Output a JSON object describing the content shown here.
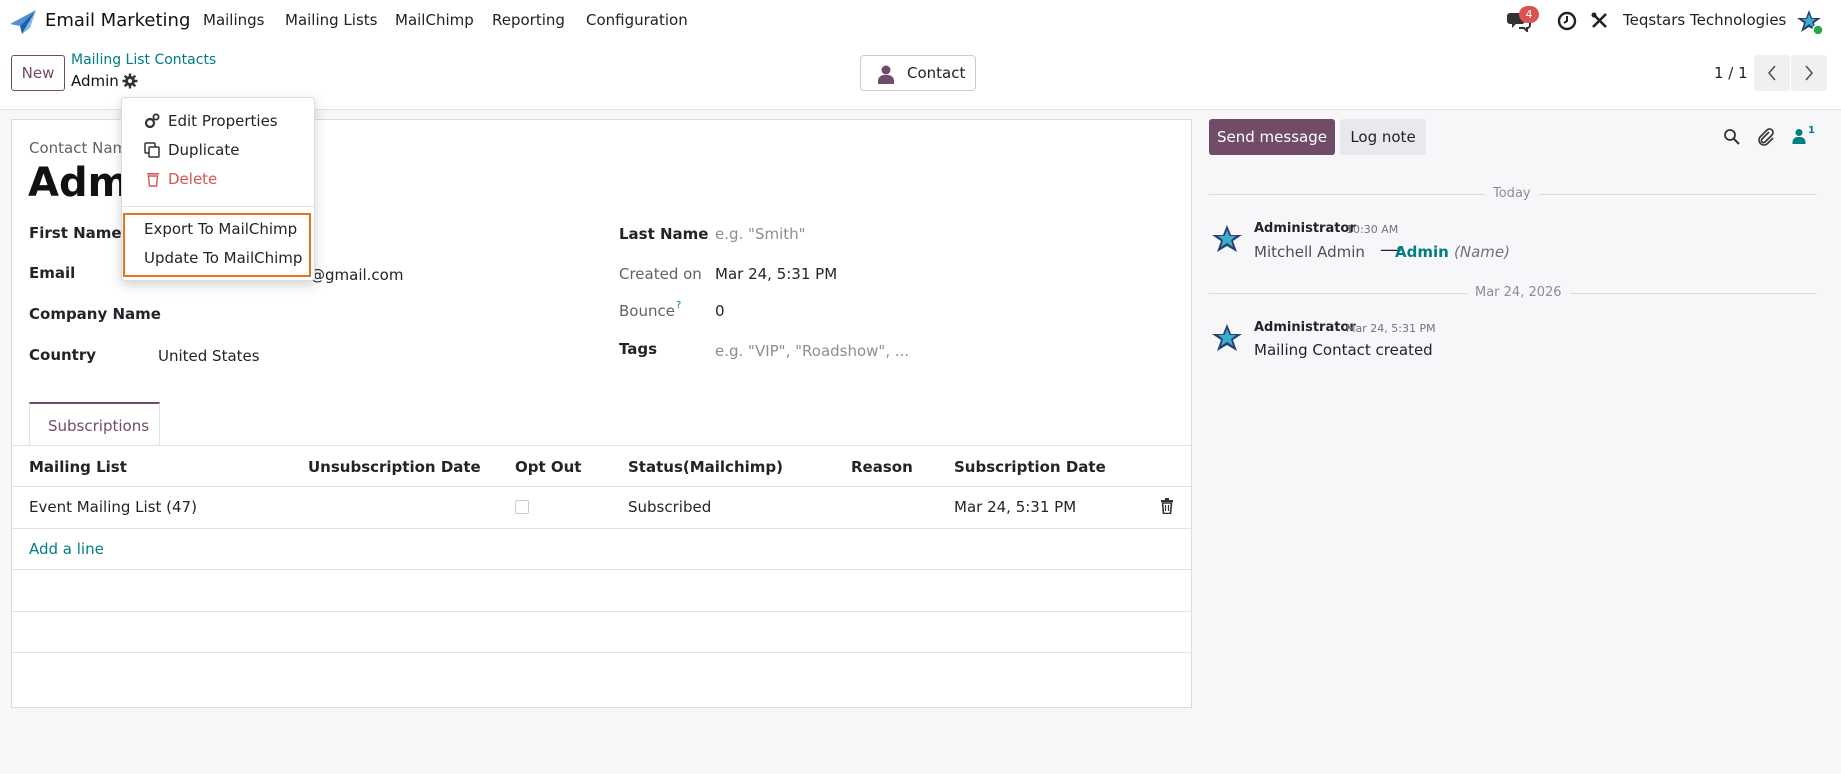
{
  "app": {
    "name": "Email Marketing"
  },
  "nav": {
    "menus": [
      "Mailings",
      "Mailing Lists",
      "MailChimp",
      "Reporting",
      "Configuration"
    ],
    "messages_badge": "4",
    "company": "Teqstars Technologies"
  },
  "control": {
    "new_label": "New",
    "breadcrumb_parent": "Mailing List Contacts",
    "breadcrumb_current": "Admin",
    "contact_button": "Contact",
    "pager": "1 / 1"
  },
  "dropdown": {
    "items": [
      "Edit Properties",
      "Duplicate",
      "Delete"
    ],
    "mailchimp_items": [
      "Export To MailChimp",
      "Update To MailChimp"
    ]
  },
  "form": {
    "contact_name_label": "Contact Nam",
    "contact_name": "Admi",
    "first_name_label": "First Name",
    "email_label": "Email",
    "email_value": "@gmail.com",
    "company_label": "Company Name",
    "country_label": "Country",
    "country_value": "United States",
    "last_name_label": "Last Name",
    "last_name_placeholder": "e.g. \"Smith\"",
    "created_on_label": "Created on",
    "created_on_value": "Mar 24, 5:31 PM",
    "bounce_label": "Bounce",
    "bounce_help": "?",
    "bounce_value": "0",
    "tags_label": "Tags",
    "tags_placeholder": "e.g. \"VIP\", \"Roadshow\", ..."
  },
  "subscriptions": {
    "tab_label": "Subscriptions",
    "columns": [
      "Mailing List",
      "Unsubscription Date",
      "Opt Out",
      "Status(Mailchimp)",
      "Reason",
      "Subscription Date"
    ],
    "rows": [
      {
        "mailing_list": "Event Mailing List (47)",
        "unsubscription_date": "",
        "opt_out": false,
        "status": "Subscribed",
        "reason": "",
        "subscription_date": "Mar 24, 5:31 PM"
      }
    ],
    "add_line": "Add a line"
  },
  "chatter": {
    "send_message": "Send message",
    "log_note": "Log note",
    "followers_count": "1",
    "groups": [
      {
        "date_label": "Today",
        "messages": [
          {
            "author": "Administrator",
            "time": "10:30 AM",
            "old_value": "Mitchell Admin",
            "arrow": "⟶",
            "new_value": "Admin",
            "field": "(Name)"
          }
        ]
      },
      {
        "date_label": "Mar 24, 2026",
        "messages": [
          {
            "author": "Administrator",
            "time": "Mar 24, 5:31 PM",
            "body": "Mailing Contact created"
          }
        ]
      }
    ]
  },
  "colors": {
    "brand": "#714b67",
    "link": "#017e84",
    "danger": "#d9534f",
    "highlight": "#e8741e"
  }
}
